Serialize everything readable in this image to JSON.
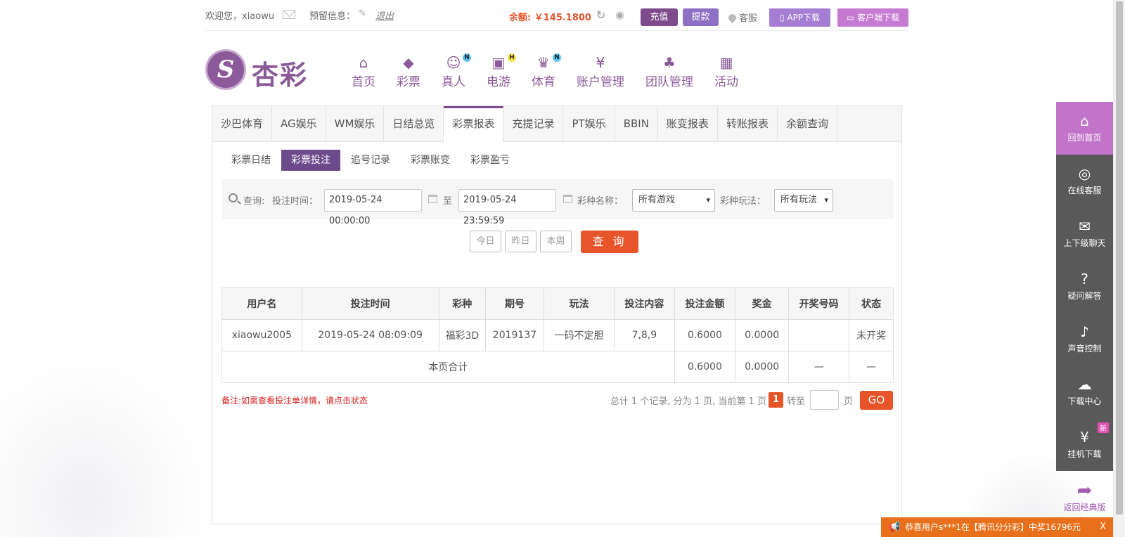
{
  "topbar": {
    "welcome": "欢迎您，xiaowu",
    "reserve_label": "预留信息：",
    "logout": "退出",
    "balance": "余额: ￥145.1800",
    "recharge": "充值",
    "withdraw": "提款",
    "customer_service": "客服",
    "app_download": "APP下载",
    "pc_download": "客户端下载"
  },
  "logo": {
    "name": "杏彩"
  },
  "nav": [
    {
      "label": "首页",
      "icon": "home-icon",
      "glyph": "⌂"
    },
    {
      "label": "彩票",
      "icon": "ticket-icon",
      "glyph": "◆"
    },
    {
      "label": "真人",
      "icon": "live-dealer-icon",
      "glyph": "☺",
      "badge": "N"
    },
    {
      "label": "电游",
      "icon": "gamepad-icon",
      "glyph": "▣",
      "badge": "H"
    },
    {
      "label": "体育",
      "icon": "trophy-icon",
      "glyph": "♛",
      "badge": "N"
    },
    {
      "label": "账户管理",
      "icon": "yen-coin-icon",
      "glyph": "¥"
    },
    {
      "label": "团队管理",
      "icon": "team-icon",
      "glyph": "♣"
    },
    {
      "label": "活动",
      "icon": "gift-icon",
      "glyph": "▦"
    }
  ],
  "report_tabs": [
    "沙巴体育",
    "AG娱乐",
    "WM娱乐",
    "日结总览",
    "彩票报表",
    "充提记录",
    "PT娱乐",
    "BBIN",
    "账变报表",
    "转账报表",
    "余额查询"
  ],
  "report_tabs_active": "彩票报表",
  "sub_tabs": [
    "彩票日结",
    "彩票投注",
    "追号记录",
    "彩票账变",
    "彩票盈亏"
  ],
  "sub_tabs_active": "彩票投注",
  "query": {
    "label": "查询:",
    "time_label": "投注时间：",
    "start": "2019-05-24 00:00:00",
    "to": "至",
    "end": "2019-05-24 23:59:59",
    "game_label": "彩种名称：",
    "game_value": "所有游戏",
    "play_label": "彩种玩法：",
    "play_value": "所有玩法"
  },
  "quick_buttons": {
    "today": "今日",
    "yesterday": "昨日",
    "week": "本周",
    "search": "查 询"
  },
  "table": {
    "headers": [
      "用户名",
      "投注时间",
      "彩种",
      "期号",
      "玩法",
      "投注内容",
      "投注金额",
      "奖金",
      "开奖号码",
      "状态"
    ],
    "rows": [
      [
        "xiaowu2005",
        "2019-05-24 08:09:09",
        "福彩3D",
        "2019137",
        "一码不定胆",
        "7,8,9",
        "0.6000",
        "0.0000",
        "",
        "未开奖"
      ]
    ],
    "summary": {
      "label": "本页合计",
      "amount": "0.6000",
      "bonus": "0.0000",
      "draw": "—",
      "status": "—"
    }
  },
  "note": "备注:如需查看投注单详情，请点击状态",
  "pager": {
    "info": "总计 1 个记录, 分为 1 页, 当前第 1 页",
    "current": "1",
    "goto": "转至",
    "page": "页",
    "go": "GO"
  },
  "sidebar": [
    {
      "label": "回到首页",
      "icon": "home-icon",
      "glyph": "⌂"
    },
    {
      "label": "在线客服",
      "icon": "support-24-icon",
      "glyph": "◎"
    },
    {
      "label": "上下级聊天",
      "icon": "chat-bubble-icon",
      "glyph": "✉"
    },
    {
      "label": "疑问解答",
      "icon": "question-icon",
      "glyph": "?"
    },
    {
      "label": "声音控制",
      "icon": "speaker-icon",
      "glyph": "♪"
    },
    {
      "label": "下载中心",
      "icon": "cloud-download-icon",
      "glyph": "☁"
    },
    {
      "label": "挂机下载",
      "icon": "money-bag-icon",
      "glyph": "¥",
      "badge": "新"
    }
  ],
  "back_classic": "返回经典版",
  "ticker": "恭喜用户s***1在【腾讯分分彩】中奖16796元",
  "colors": {
    "brand": "#7e4b8c",
    "accent": "#e8542a",
    "sidebar": "#595959",
    "sidebar_active": "#c174c9"
  }
}
